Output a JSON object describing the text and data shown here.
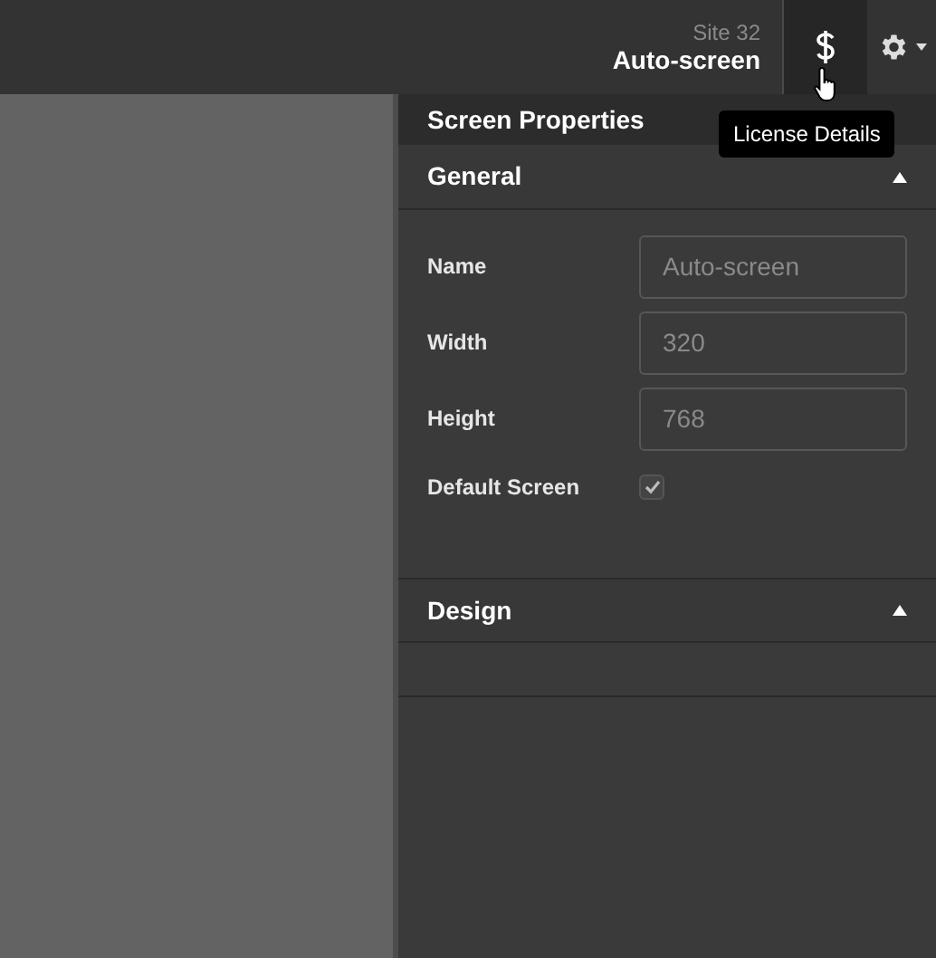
{
  "header": {
    "site": "Site 32",
    "screen": "Auto-screen",
    "tooltip": "License Details"
  },
  "panel": {
    "title": "Screen Properties",
    "sections": [
      {
        "title": "General",
        "expanded": true,
        "fields": [
          {
            "kind": "text",
            "label": "Name",
            "value": "Auto-screen"
          },
          {
            "kind": "text",
            "label": "Width",
            "value": "320"
          },
          {
            "kind": "text",
            "label": "Height",
            "value": "768"
          },
          {
            "kind": "checkbox",
            "label": "Default Screen",
            "checked": true
          }
        ]
      },
      {
        "title": "Design",
        "expanded": true
      }
    ]
  }
}
